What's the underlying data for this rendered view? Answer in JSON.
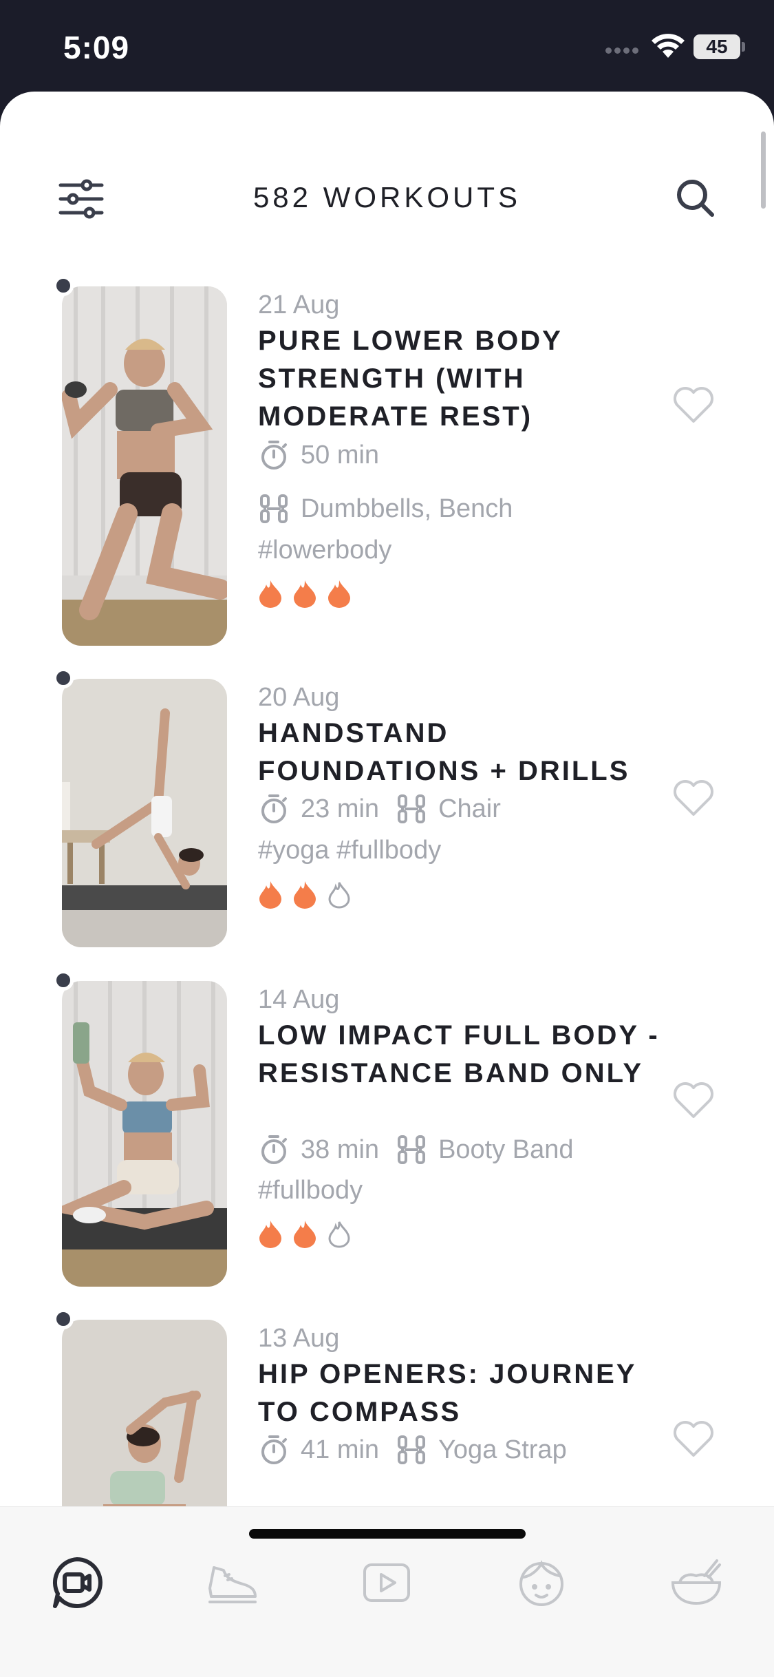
{
  "status_bar": {
    "time": "5:09",
    "battery": "45"
  },
  "header": {
    "title": "582 WORKOUTS",
    "filter_icon": "sliders-icon",
    "search_icon": "search-icon"
  },
  "workouts": [
    {
      "date": "21 Aug",
      "title": "PURE LOWER BODY STRENGTH (WITH MODERATE REST)",
      "duration": "50 min",
      "equipment": "Dumbbells, Bench",
      "tags": "#lowerbody",
      "intensity": 3,
      "intensity_max": 3
    },
    {
      "date": "20 Aug",
      "title": "HANDSTAND FOUNDATIONS + DRILLS",
      "duration": "23 min",
      "equipment": "Chair",
      "tags": "#yoga #fullbody",
      "intensity": 2,
      "intensity_max": 3
    },
    {
      "date": "14 Aug",
      "title": "LOW IMPACT FULL BODY - RESISTANCE BAND ONLY",
      "duration": "38 min",
      "equipment": "Booty Band",
      "tags": "#fullbody",
      "intensity": 2,
      "intensity_max": 3
    },
    {
      "date": "13 Aug",
      "title": "HIP OPENERS: JOURNEY TO COMPASS",
      "duration": "41 min",
      "equipment": "Yoga Strap"
    }
  ],
  "tab_bar": [
    {
      "icon": "workouts-icon",
      "active": true
    },
    {
      "icon": "sneaker-icon",
      "active": false
    },
    {
      "icon": "video-play-icon",
      "active": false
    },
    {
      "icon": "face-icon",
      "active": false
    },
    {
      "icon": "bowl-icon",
      "active": false
    }
  ],
  "colors": {
    "flame": "#f47d4a",
    "muted_text": "#a3a6ad",
    "title_text": "#1f2027",
    "status_bar_bg": "#1b1c29"
  }
}
